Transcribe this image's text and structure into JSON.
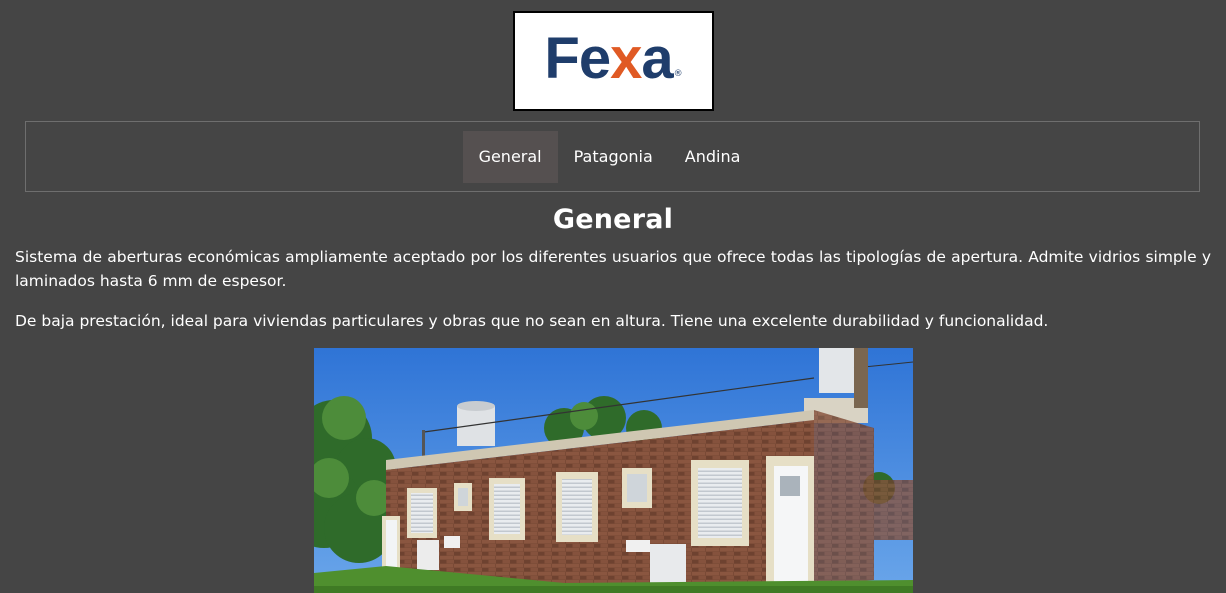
{
  "logo": {
    "brand": "Fexa",
    "wordmark_pre": "Fe",
    "wordmark_x": "x",
    "wordmark_post": "a",
    "registered": "®"
  },
  "nav": {
    "tabs": [
      {
        "label": "General",
        "active": true
      },
      {
        "label": "Patagonia",
        "active": false
      },
      {
        "label": "Andina",
        "active": false
      }
    ]
  },
  "content": {
    "title": "General",
    "paragraphs": [
      "Sistema de aberturas económicas ampliamente aceptado por los diferentes usuarios que ofrece todas las tipologías de apertura. Admite vidrios simple y laminados hasta 6 mm de espesor.",
      "De baja prestación, ideal para viviendas particulares y obras que no sean en altura. Tiene una excelente durabilidad y funcionalidad."
    ]
  },
  "colors": {
    "background": "#454545",
    "active_tab": "#555050",
    "logo_blue": "#1f3d6b",
    "logo_orange": "#e05a24"
  }
}
